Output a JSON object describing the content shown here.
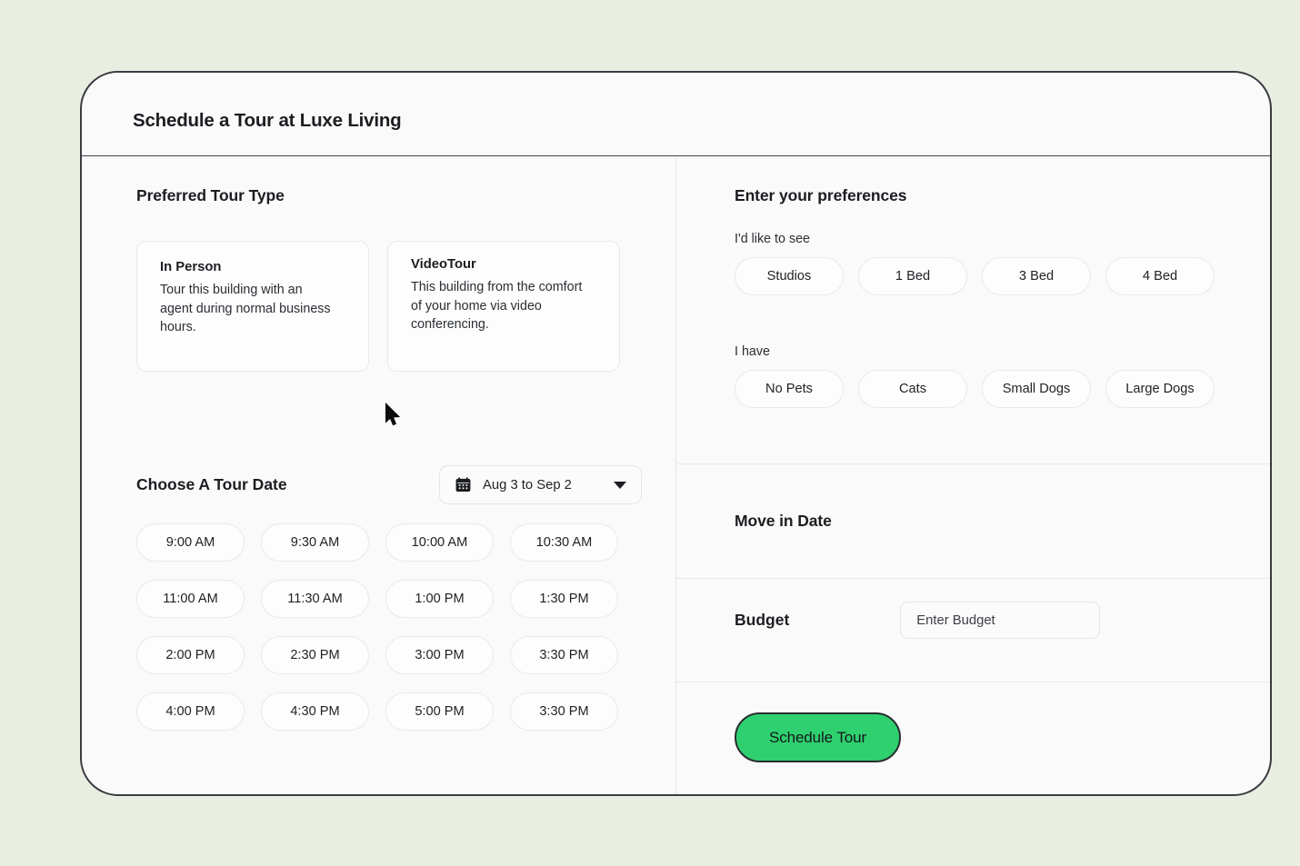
{
  "header": {
    "title": "Schedule a Tour at Luxe Living"
  },
  "left": {
    "tour_type_heading": "Preferred Tour Type",
    "tour_types": [
      {
        "title": "In Person",
        "description": "Tour this building with an agent during normal business hours."
      },
      {
        "title": "VideoTour",
        "description": "This building from the comfort of your home via video conferencing."
      }
    ],
    "date_label": "Choose A Tour Date",
    "date_value": "Aug 3 to Sep 2",
    "calendar_icon": "calendar-icon",
    "chevron_icon": "chevron-down-icon",
    "time_slots": [
      "9:00 AM",
      "9:30 AM",
      "10:00 AM",
      "10:30 AM",
      "11:00 AM",
      "11:30 AM",
      "1:00 PM",
      "1:30 PM",
      "2:00 PM",
      "2:30 PM",
      "3:00 PM",
      "3:30 PM",
      "4:00 PM",
      "4:30 PM",
      "5:00 PM",
      "3:30 PM"
    ]
  },
  "right": {
    "preferences_heading": "Enter your preferences",
    "bedrooms_label": "I'd like to see",
    "bedrooms": [
      "Studios",
      "1 Bed",
      "3 Bed",
      "4 Bed"
    ],
    "pets_label": "I have",
    "pets": [
      "No Pets",
      "Cats",
      "Small Dogs",
      "Large Dogs"
    ],
    "movein_heading": "Move in Date",
    "budget_label": "Budget",
    "budget_placeholder": "Enter Budget",
    "budget_value": "",
    "submit_label": "Schedule Tour"
  },
  "colors": {
    "page_background": "#eaeee2",
    "card_background": "#fafafa",
    "card_border": "#3a3d42",
    "accent_green": "#2ed06f",
    "text_primary": "#1b1d21",
    "divider": "#e8e8e8"
  }
}
